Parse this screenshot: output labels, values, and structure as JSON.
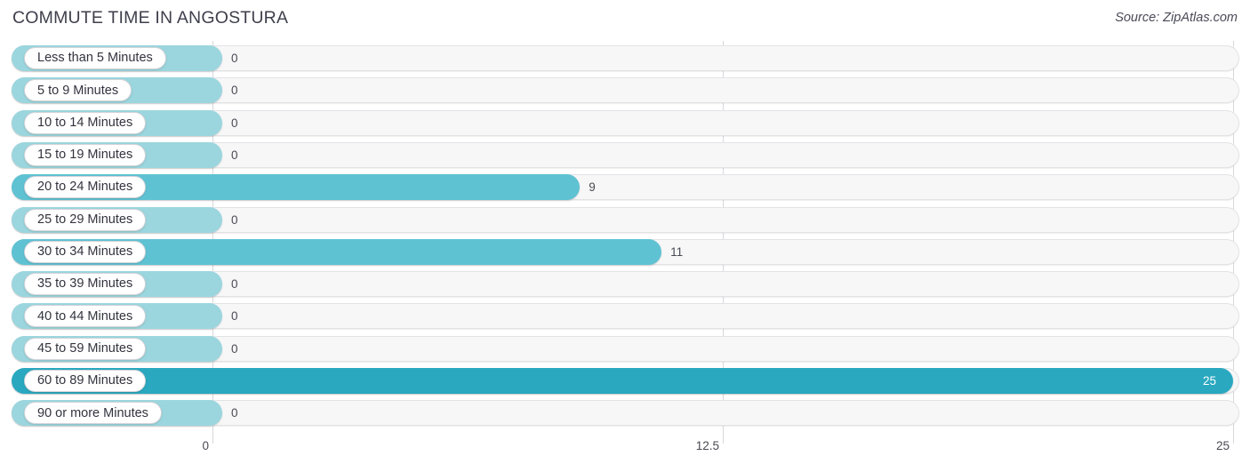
{
  "header": {
    "title": "COMMUTE TIME IN ANGOSTURA",
    "source": "Source: ZipAtlas.com"
  },
  "colors": {
    "bar_zero": "#9bd6de",
    "bar_mid": "#5fc2d3",
    "bar_max": "#29a8c0",
    "track": "#f7f7f8",
    "track_border": "#e3e3e6",
    "gridline": "#d8d8dc",
    "text": "#3a3a46",
    "value_inside": "#ffffff"
  },
  "chart_data": {
    "type": "bar",
    "orientation": "horizontal",
    "title": "COMMUTE TIME IN ANGOSTURA",
    "xlabel": "",
    "ylabel": "",
    "xlim": [
      0,
      25
    ],
    "grid": true,
    "legend": false,
    "axis_ticks": [
      "0",
      "12.5",
      "25"
    ],
    "axis_tick_values": [
      0,
      12.5,
      25
    ],
    "categories": [
      "Less than 5 Minutes",
      "5 to 9 Minutes",
      "10 to 14 Minutes",
      "15 to 19 Minutes",
      "20 to 24 Minutes",
      "25 to 29 Minutes",
      "30 to 34 Minutes",
      "35 to 39 Minutes",
      "40 to 44 Minutes",
      "45 to 59 Minutes",
      "60 to 89 Minutes",
      "90 or more Minutes"
    ],
    "values": [
      0,
      0,
      0,
      0,
      9,
      0,
      11,
      0,
      0,
      0,
      25,
      0
    ],
    "value_labels": [
      "0",
      "0",
      "0",
      "0",
      "9",
      "0",
      "11",
      "0",
      "0",
      "0",
      "25",
      "0"
    ]
  },
  "rows": [
    {
      "label": "Less than 5 Minutes",
      "value": 0,
      "value_label": "0",
      "style": "zero"
    },
    {
      "label": "5 to 9 Minutes",
      "value": 0,
      "value_label": "0",
      "style": "zero"
    },
    {
      "label": "10 to 14 Minutes",
      "value": 0,
      "value_label": "0",
      "style": "zero"
    },
    {
      "label": "15 to 19 Minutes",
      "value": 0,
      "value_label": "0",
      "style": "zero"
    },
    {
      "label": "20 to 24 Minutes",
      "value": 9,
      "value_label": "9",
      "style": "mid"
    },
    {
      "label": "25 to 29 Minutes",
      "value": 0,
      "value_label": "0",
      "style": "zero"
    },
    {
      "label": "30 to 34 Minutes",
      "value": 11,
      "value_label": "11",
      "style": "mid"
    },
    {
      "label": "35 to 39 Minutes",
      "value": 0,
      "value_label": "0",
      "style": "zero"
    },
    {
      "label": "40 to 44 Minutes",
      "value": 0,
      "value_label": "0",
      "style": "zero"
    },
    {
      "label": "45 to 59 Minutes",
      "value": 0,
      "value_label": "0",
      "style": "zero"
    },
    {
      "label": "60 to 89 Minutes",
      "value": 25,
      "value_label": "25",
      "style": "max"
    },
    {
      "label": "90 or more Minutes",
      "value": 0,
      "value_label": "0",
      "style": "zero"
    }
  ]
}
